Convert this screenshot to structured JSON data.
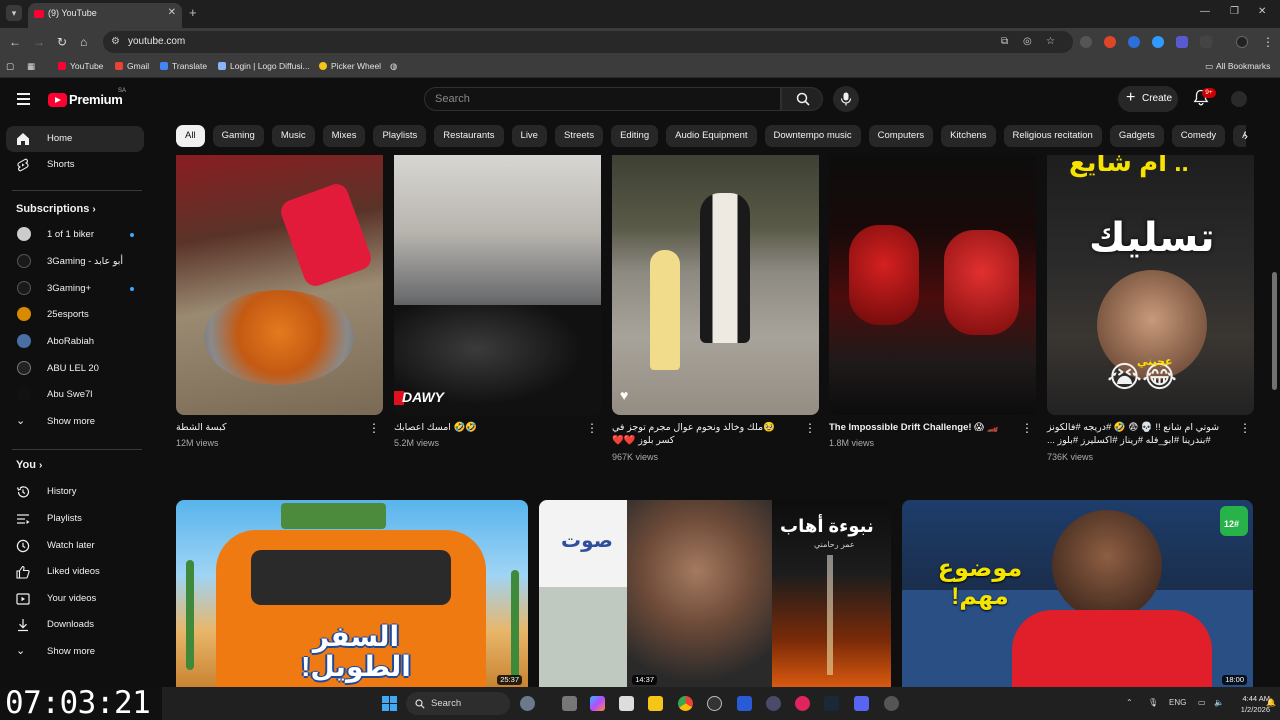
{
  "browser": {
    "tab_title": "(9) YouTube",
    "url": "youtube.com",
    "bookmarks": [
      "YouTube",
      "Gmail",
      "Translate",
      "Login | Logo Diffusi...",
      "Picker Wheel"
    ],
    "all_bookmarks": "All Bookmarks"
  },
  "header": {
    "logo": "Premium",
    "logo_region": "SA",
    "search_placeholder": "Search",
    "create_label": "Create",
    "notification_count": "9+"
  },
  "sidebar": {
    "primary": [
      {
        "label": "Home",
        "icon": "home-icon"
      },
      {
        "label": "Shorts",
        "icon": "shorts-icon"
      }
    ],
    "subscriptions_title": "Subscriptions",
    "subscriptions": [
      {
        "label": "1 of 1 biker",
        "live": true
      },
      {
        "label": "3Gaming - أبو عابد",
        "live": false
      },
      {
        "label": "3Gaming+",
        "live": true
      },
      {
        "label": "25esports",
        "live": false
      },
      {
        "label": "AboRabiah",
        "live": false
      },
      {
        "label": "ABU LEL 20",
        "live": false
      },
      {
        "label": "Abu Swe7l",
        "live": false
      }
    ],
    "show_more": "Show more",
    "you_title": "You",
    "you_items": [
      {
        "label": "History",
        "icon": "history-icon"
      },
      {
        "label": "Playlists",
        "icon": "playlists-icon"
      },
      {
        "label": "Watch later",
        "icon": "watch-later-icon"
      },
      {
        "label": "Liked videos",
        "icon": "like-icon"
      },
      {
        "label": "Your videos",
        "icon": "your-videos-icon"
      },
      {
        "label": "Downloads",
        "icon": "download-icon"
      }
    ],
    "show_more_2": "Show more"
  },
  "chips": [
    "All",
    "Gaming",
    "Music",
    "Mixes",
    "Playlists",
    "Restaurants",
    "Live",
    "Streets",
    "Editing",
    "Audio Equipment",
    "Downtempo music",
    "Computers",
    "Kitchens",
    "Religious recitation",
    "Gadgets",
    "Comedy",
    "Action-a"
  ],
  "shorts": [
    {
      "title": "كبسة الشطة",
      "views": "12M views"
    },
    {
      "title": "🤣🤣 امسك اعصابك",
      "views": "5.2M views",
      "overlay": "DAWY"
    },
    {
      "title": "🥹ملك وخالد ونحوم عوال مجرم توجز في كسر بلوز ❤️❤️",
      "views": "967K views"
    },
    {
      "title": "The Impossible Drift Challenge! 😱 🏎️",
      "views": "1.8M views"
    },
    {
      "title": "شوتي ام شانع !! 💀 😨 🤣 #دريجه #فالكونز #بندرينا #ابو_فله #ريناز #اكسليرز #بلوز ...",
      "views": "736K views",
      "overlay": "تسليك",
      "overlay_top": "ام شايع ..",
      "overlay_small": "عجبني"
    }
  ],
  "videos": [
    {
      "duration": "25:37",
      "overlay": "السفر الطويل!"
    },
    {
      "duration": "14:37",
      "overlay_left": "صوت",
      "overlay_right": "نبوءة أهاب",
      "overlay_author": "عمر رحامني"
    },
    {
      "duration": "18:00",
      "overlay": "موضوع مهم!",
      "badge": "12#"
    }
  ],
  "overlay_clock": "07:03:21",
  "taskbar": {
    "search_label": "Search",
    "lang": "ENG",
    "time": "4:44 AM",
    "date": "1/2/2026"
  }
}
